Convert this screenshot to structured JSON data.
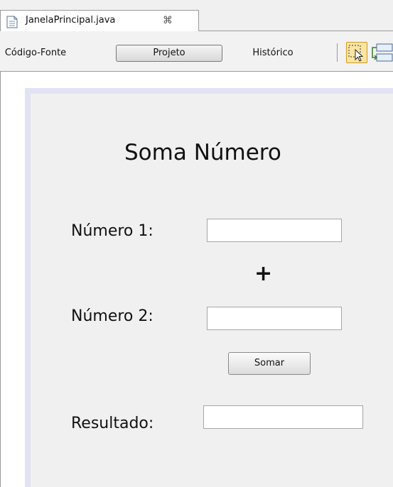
{
  "editor_tab": {
    "file_name": "JanelaPrincipal.java",
    "close_glyph": "⌘",
    "icon": "java-file-icon"
  },
  "toolbar": {
    "source_label": "Código-Fonte",
    "design_label": "Projeto",
    "history_label": "Histórico",
    "selection_icon": "selection-mode-icon",
    "connection_icon": "connection-mode-icon"
  },
  "form": {
    "title": "Soma Número",
    "number1_label": "Número 1:",
    "number1_value": "",
    "plus_sign": "+",
    "number2_label": "Número 2:",
    "number2_value": "",
    "sum_button_label": "Somar",
    "result_label": "Resultado:",
    "result_value": ""
  },
  "colors": {
    "toolbar_bg": "#f2f2f2",
    "canvas_bg": "#f0f0f0",
    "frame_border": "#e1e3f3",
    "selection_tool_bg": "#fbe5a4"
  }
}
